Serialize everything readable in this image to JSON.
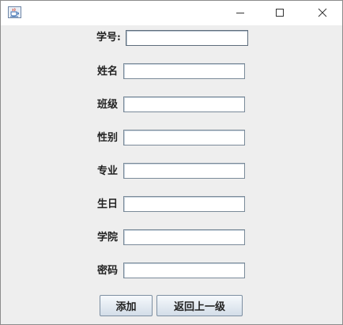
{
  "window": {
    "icon": "java-cup-icon",
    "controls": {
      "minimize": "minimize-icon",
      "maximize": "maximize-icon",
      "close": "close-icon"
    }
  },
  "form": {
    "fields": [
      {
        "label": "学号:",
        "value": ""
      },
      {
        "label": "姓名",
        "value": ""
      },
      {
        "label": "班级",
        "value": ""
      },
      {
        "label": "性别",
        "value": ""
      },
      {
        "label": "专业",
        "value": ""
      },
      {
        "label": "生日",
        "value": ""
      },
      {
        "label": "学院",
        "value": ""
      },
      {
        "label": "密码",
        "value": ""
      }
    ]
  },
  "buttons": {
    "add_label": "添加",
    "back_label": "返回上一级"
  },
  "colors": {
    "titlebar_bg": "#ffffff",
    "window_bg": "#eeeeee",
    "field_border": "#7a8a99",
    "button_border": "#7d8fa2"
  }
}
